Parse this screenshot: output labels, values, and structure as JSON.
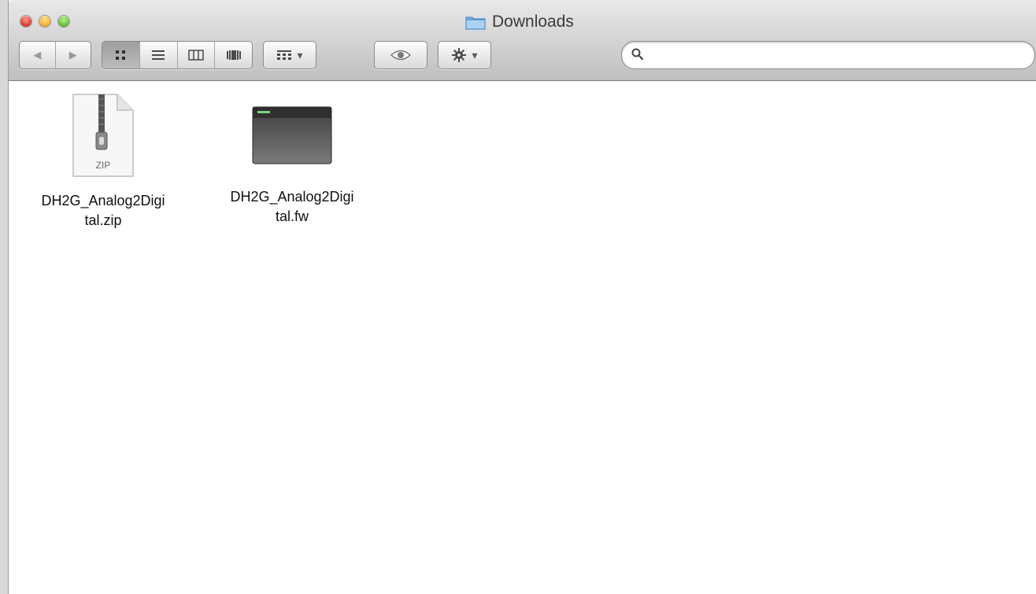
{
  "window": {
    "title": "Downloads"
  },
  "toolbar": {
    "back": "◀",
    "forward": "▶",
    "views": [
      "icon-view",
      "list-view",
      "column-view",
      "coverflow-view"
    ],
    "active_view": "icon-view",
    "arrange_caret": "▾",
    "action_caret": "▾"
  },
  "search": {
    "value": "",
    "placeholder": ""
  },
  "files": [
    {
      "name": "DH2G_Analog2Digi\ntal.zip",
      "badge": "ZIP",
      "type": "zip-archive-icon"
    },
    {
      "name": "DH2G_Analog2Digi\ntal.fw",
      "badge": "",
      "type": "firmware-file-icon"
    }
  ],
  "colors": {
    "folder": "#5fa3e0",
    "dark_file": "#4a4a4a",
    "close": "#e0443a",
    "minimize": "#f4b43a",
    "zoom": "#6ac444"
  }
}
